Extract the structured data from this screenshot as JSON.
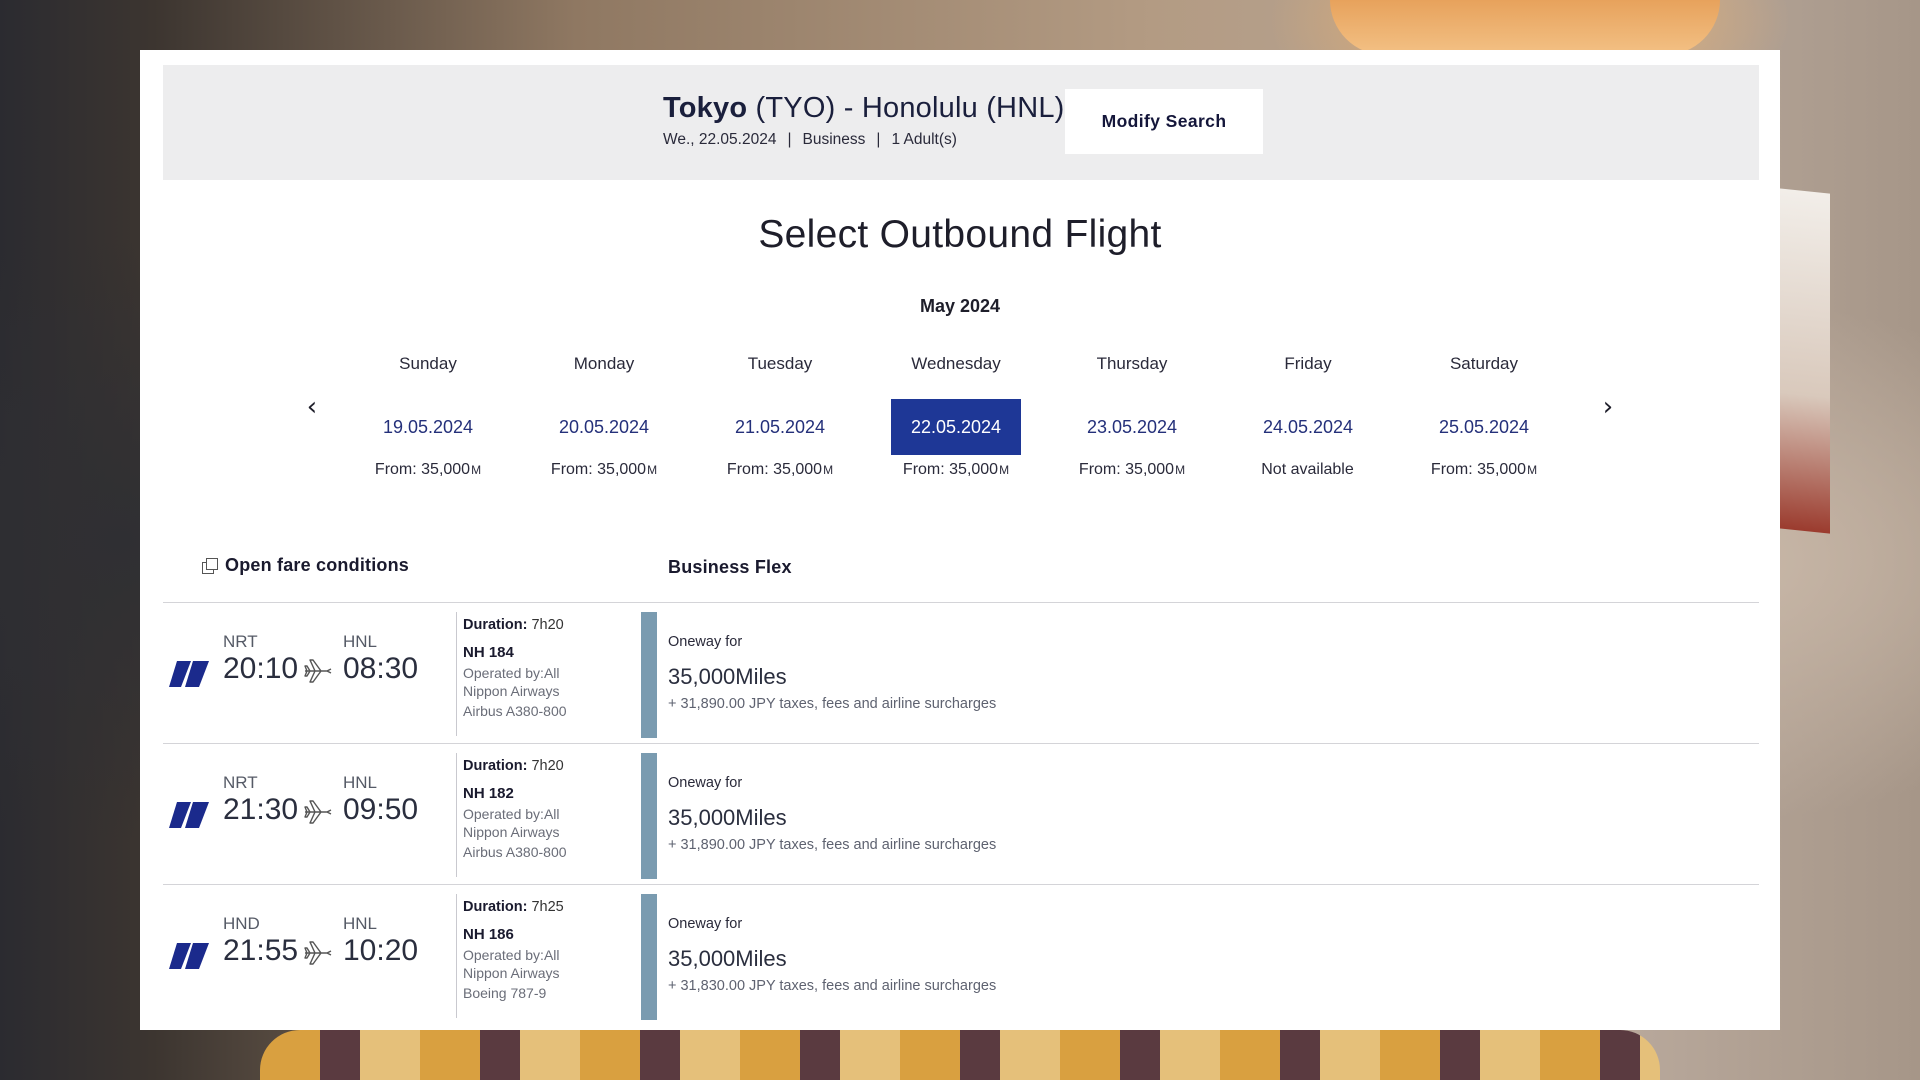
{
  "search": {
    "origin_city": "Tokyo",
    "origin_code": "(TYO)",
    "separator": "-",
    "dest_city": "Honolulu",
    "dest_code": "(HNL)",
    "date": "We., 22.05.2024",
    "cabin": "Business",
    "passengers": "1 Adult(s)",
    "divider": "|",
    "modify_label": "Modify Search"
  },
  "heading": "Select Outbound Flight",
  "month": "May 2024",
  "nav": {
    "prev_icon": "chevron-left-icon",
    "next_icon": "chevron-right-icon",
    "prev_glyph": "‹",
    "next_glyph": "›"
  },
  "days": [
    {
      "name": "Sunday",
      "date": "19.05.2024",
      "price": "From: 35,000",
      "unit": "M",
      "selected": false
    },
    {
      "name": "Monday",
      "date": "20.05.2024",
      "price": "From: 35,000",
      "unit": "M",
      "selected": false
    },
    {
      "name": "Tuesday",
      "date": "21.05.2024",
      "price": "From: 35,000",
      "unit": "M",
      "selected": false
    },
    {
      "name": "Wednesday",
      "date": "22.05.2024",
      "price": "From: 35,000",
      "unit": "M",
      "selected": true
    },
    {
      "name": "Thursday",
      "date": "23.05.2024",
      "price": "From: 35,000",
      "unit": "M",
      "selected": false
    },
    {
      "name": "Friday",
      "date": "24.05.2024",
      "price": "Not available",
      "unit": "",
      "selected": false
    },
    {
      "name": "Saturday",
      "date": "25.05.2024",
      "price": "From: 35,000",
      "unit": "M",
      "selected": false
    }
  ],
  "fare_conditions_label": "Open fare conditions",
  "fare_class": "Business Flex",
  "flights": [
    {
      "dep_code": "NRT",
      "dep_time": "20:10",
      "arr_code": "HNL",
      "arr_time": "08:30",
      "duration_label": "Duration:",
      "duration": "7h20",
      "flight_no": "NH 184",
      "operated_by": "Operated by:All Nippon Airways",
      "aircraft": "Airbus A380-800",
      "oneway": "Oneway for",
      "miles": "35,000Miles",
      "taxes": "+ 31,890.00 JPY taxes, fees and airline surcharges"
    },
    {
      "dep_code": "NRT",
      "dep_time": "21:30",
      "arr_code": "HNL",
      "arr_time": "09:50",
      "duration_label": "Duration:",
      "duration": "7h20",
      "flight_no": "NH 182",
      "operated_by": "Operated by:All Nippon Airways",
      "aircraft": "Airbus A380-800",
      "oneway": "Oneway for",
      "miles": "35,000Miles",
      "taxes": "+ 31,890.00 JPY taxes, fees and airline surcharges"
    },
    {
      "dep_code": "HND",
      "dep_time": "21:55",
      "arr_code": "HNL",
      "arr_time": "10:20",
      "duration_label": "Duration:",
      "duration": "7h25",
      "flight_no": "NH 186",
      "operated_by": "Operated by:All Nippon Airways",
      "aircraft": "Boeing 787-9",
      "oneway": "Oneway for",
      "miles": "35,000Miles",
      "taxes": "+ 31,830.00 JPY taxes, fees and airline surcharges"
    }
  ],
  "colors": {
    "selected_date_bg": "#1e3796",
    "fare_bar": "#7a9bb0",
    "airline_logo": "#1b2a8c"
  }
}
